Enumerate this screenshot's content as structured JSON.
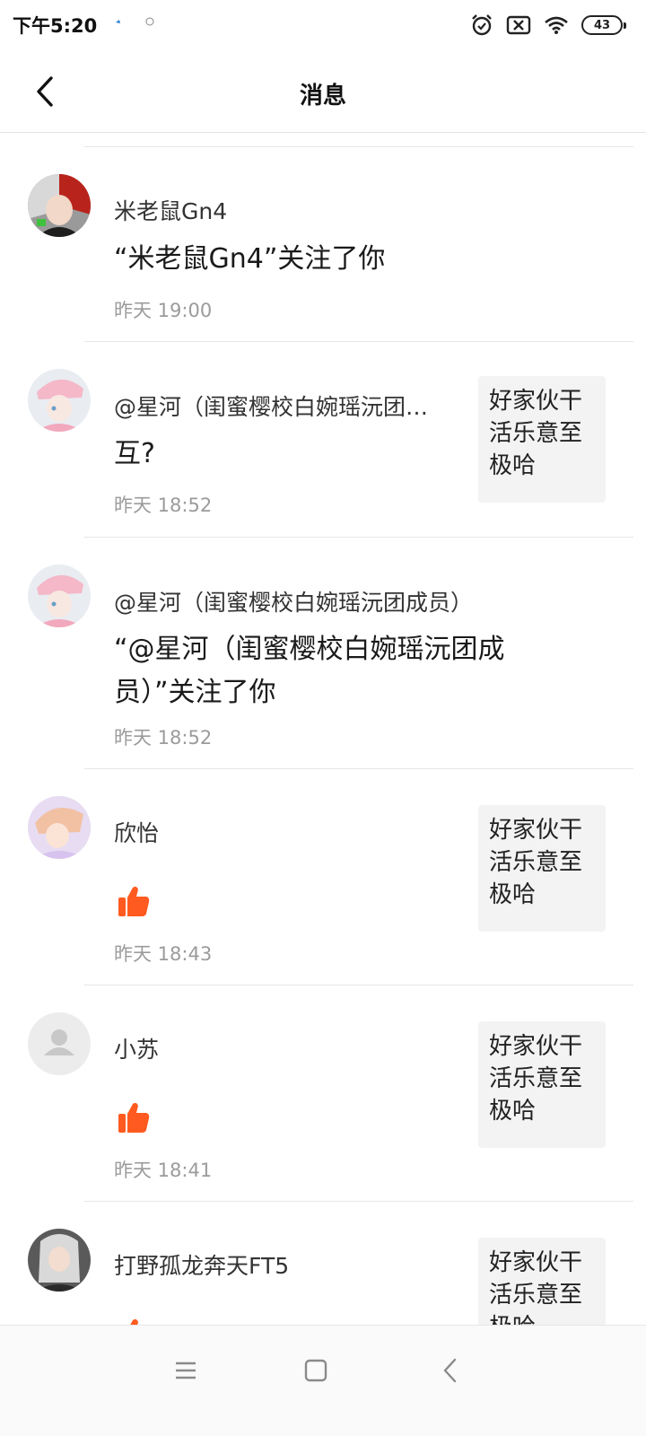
{
  "status_bar": {
    "time": "下午5:20",
    "battery": "43",
    "icons": [
      "alarm-icon",
      "sim-off-icon",
      "wifi-icon",
      "battery-icon"
    ]
  },
  "header": {
    "title": "消息",
    "back_icon": "chevron-left-icon"
  },
  "messages": [
    {
      "name": "米老鼠Gn4",
      "content": "“米老鼠Gn4”关注了你",
      "time": "昨天 19:00"
    },
    {
      "name": "@星河（闺蜜樱校白婉瑶沅团…",
      "content": "互?",
      "time": "昨天 18:52",
      "quote": "好家伙干活乐意至极哈"
    },
    {
      "name": "@星河（闺蜜樱校白婉瑶沅团成员）",
      "content": "“@星河（闺蜜樱校白婉瑶沅团成员）”关注了你",
      "time": "昨天 18:52"
    },
    {
      "name": "欣怡",
      "time": "昨天 18:43",
      "quote": "好家伙干活乐意至极哈",
      "reaction": "thumbs-up-icon"
    },
    {
      "name": "小苏",
      "time": "昨天 18:41",
      "quote": "好家伙干活乐意至极哈",
      "reaction": "thumbs-up-icon"
    },
    {
      "name": "打野孤龙奔天FT5",
      "quote": "好家伙干活乐意至极哈",
      "reaction": "thumbs-up-icon"
    }
  ],
  "nav": [
    "menu-icon",
    "home-square-icon",
    "back-triangle-icon"
  ],
  "colors": {
    "accent": "#ff5a1f",
    "divider": "#e6e6e6",
    "quote_bg": "#f3f3f3",
    "time_text": "#9b9b9b"
  }
}
